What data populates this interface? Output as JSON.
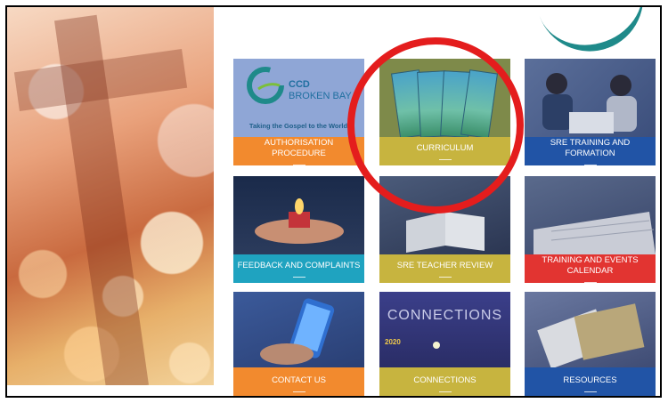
{
  "tiles": [
    {
      "id": "authorisation",
      "label": "AUTHORISATION PROCEDURE",
      "logo_text_1": "CCD",
      "logo_text_2": "BROKEN BAY",
      "tagline": "Taking the Gospel to the World",
      "color": "#f28a2e"
    },
    {
      "id": "curriculum",
      "label": "CURRICULUM",
      "color": "#c7b43f"
    },
    {
      "id": "sre-training",
      "label": "SRE TRAINING AND FORMATION",
      "color": "#2154a6"
    },
    {
      "id": "feedback",
      "label": "FEEDBACK AND COMPLAINTS",
      "color": "#1fa3c0"
    },
    {
      "id": "teacher-review",
      "label": "SRE TEACHER REVIEW",
      "color": "#c7b43f"
    },
    {
      "id": "training-events",
      "label": "TRAINING AND EVENTS CALENDAR",
      "color": "#e23431"
    },
    {
      "id": "contact",
      "label": "CONTACT US",
      "color": "#f28a2e"
    },
    {
      "id": "connections",
      "label": "CONNECTIONS",
      "image_title": "CONNECTIONS",
      "year": "2020",
      "color": "#c7b43f"
    },
    {
      "id": "resources",
      "label": "RESOURCES",
      "color": "#2154a6"
    }
  ],
  "annotation": {
    "shape": "circle",
    "color": "#e41d1d",
    "target": "curriculum"
  }
}
